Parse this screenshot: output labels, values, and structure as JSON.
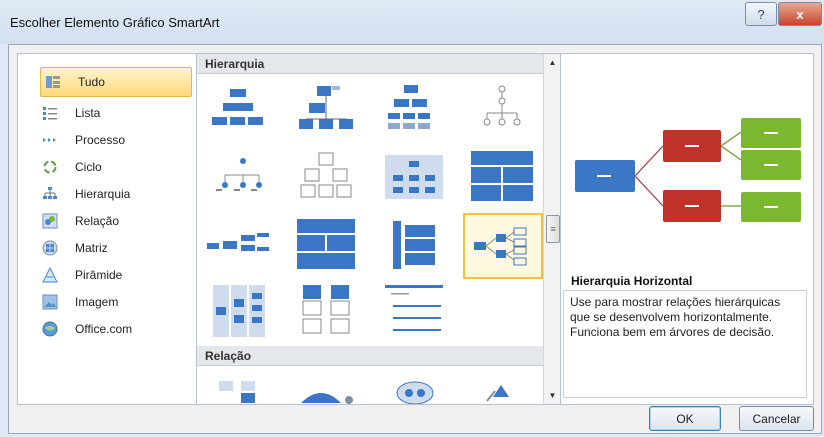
{
  "window": {
    "title": "Escolher Elemento Gráfico SmartArt",
    "help_glyph": "?",
    "close_glyph": "x"
  },
  "categories": [
    {
      "label": "Tudo",
      "icon": "all-icon",
      "selected": true
    },
    {
      "label": "Lista",
      "icon": "list-icon"
    },
    {
      "label": "Processo",
      "icon": "process-icon"
    },
    {
      "label": "Ciclo",
      "icon": "cycle-icon"
    },
    {
      "label": "Hierarquia",
      "icon": "hierarchy-icon"
    },
    {
      "label": "Relação",
      "icon": "relationship-icon"
    },
    {
      "label": "Matriz",
      "icon": "matrix-icon"
    },
    {
      "label": "Pirâmide",
      "icon": "pyramid-icon"
    },
    {
      "label": "Imagem",
      "icon": "picture-icon"
    },
    {
      "label": "Office.com",
      "icon": "office-com-icon"
    }
  ],
  "gallery": {
    "sections": [
      {
        "label": "Hierarquia"
      },
      {
        "label": "Relação"
      }
    ],
    "selected_layout": "Hierarquia Horizontal"
  },
  "details": {
    "title": "Hierarquia Horizontal",
    "description": "Use para mostrar relações hierárquicas que se desenvolvem horizontalmente. Funciona bem em árvores de decisão."
  },
  "buttons": {
    "ok": "OK",
    "cancel": "Cancelar"
  },
  "colors": {
    "accent_blue": "#3a76c4",
    "red": "#c0312a",
    "green": "#7ab830",
    "selection": "#f0c243"
  }
}
